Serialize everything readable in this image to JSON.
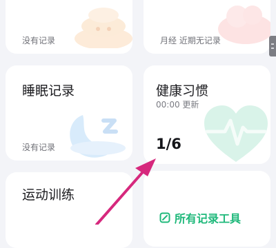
{
  "cards": {
    "poop": {
      "status": "没有记录"
    },
    "period": {
      "status": "月经  近期无记录"
    },
    "sleep": {
      "title": "睡眠记录",
      "status": "没有记录"
    },
    "habit": {
      "title": "健康习惯",
      "updated": "00:00 更新",
      "progress": "1/6"
    },
    "exercise": {
      "title": "运动训练"
    }
  },
  "tools": {
    "label": "所有记录工具"
  },
  "colors": {
    "accent": "#1eb87a",
    "arrow": "#d6287d"
  }
}
